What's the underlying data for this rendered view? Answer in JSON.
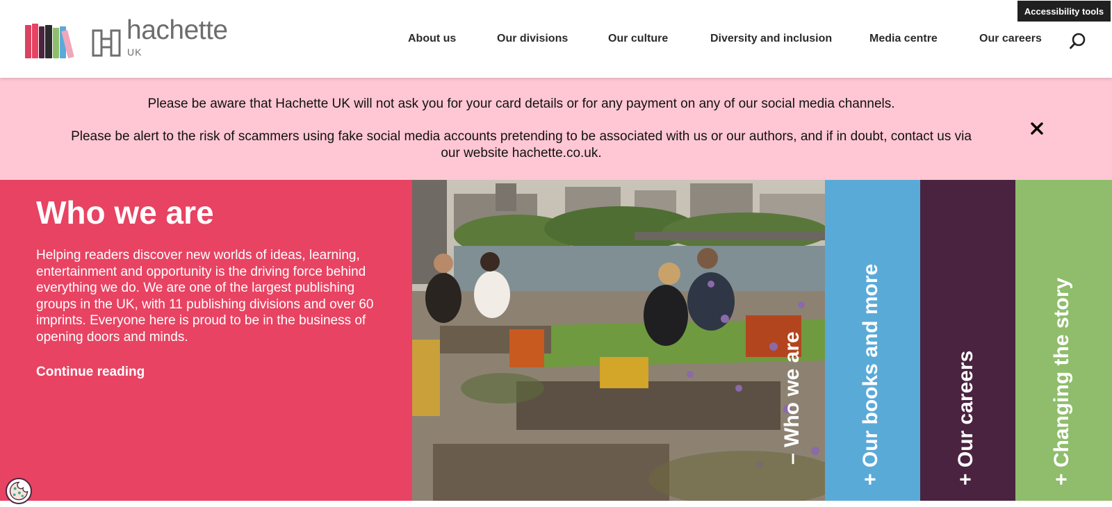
{
  "header": {
    "logo_text": "hachette",
    "logo_sub": "UK",
    "accessibility_label": "Accessibility tools",
    "nav": [
      {
        "label": "About us"
      },
      {
        "label": "Our divisions"
      },
      {
        "label": "Our culture"
      },
      {
        "label": "Diversity and inclusion"
      },
      {
        "label": "Media centre"
      },
      {
        "label": "Our careers"
      }
    ],
    "search_icon": "search-icon"
  },
  "alert": {
    "line1": "Please be aware that Hachette UK will not ask you for your card details or for any payment on any of our social media channels.",
    "line2": "Please be alert to the risk of scammers using fake social media accounts pretending to be associated with us or our authors, and if in doubt, contact us via our website hachette.co.uk.",
    "close_icon": "close-icon",
    "background": "#ffc7d3"
  },
  "hero": {
    "title": "Who we are",
    "body": "Helping readers discover new worlds of ideas, learning, entertainment and opportunity is the driving force behind everything we do. We are one of the largest publishing groups in the UK, with 11 publishing divisions and over 60 imprints. Everyone here is proud to be in the business of opening doors and minds.",
    "link": "Continue reading",
    "background": "#e84362"
  },
  "panels": [
    {
      "label": "– Who we are",
      "color": "transparent"
    },
    {
      "label": "+ Our books and more",
      "color": "#5aaad8"
    },
    {
      "label": "+ Our careers",
      "color": "#4a2340"
    },
    {
      "label": "+ Changing the story",
      "color": "#8fbd6b"
    }
  ],
  "colors": {
    "book_spines": [
      "#d94360",
      "#4a2340",
      "#e84362",
      "#2b2b2b",
      "#8fbd6b",
      "#5aaad8",
      "#f0a6bb"
    ]
  }
}
